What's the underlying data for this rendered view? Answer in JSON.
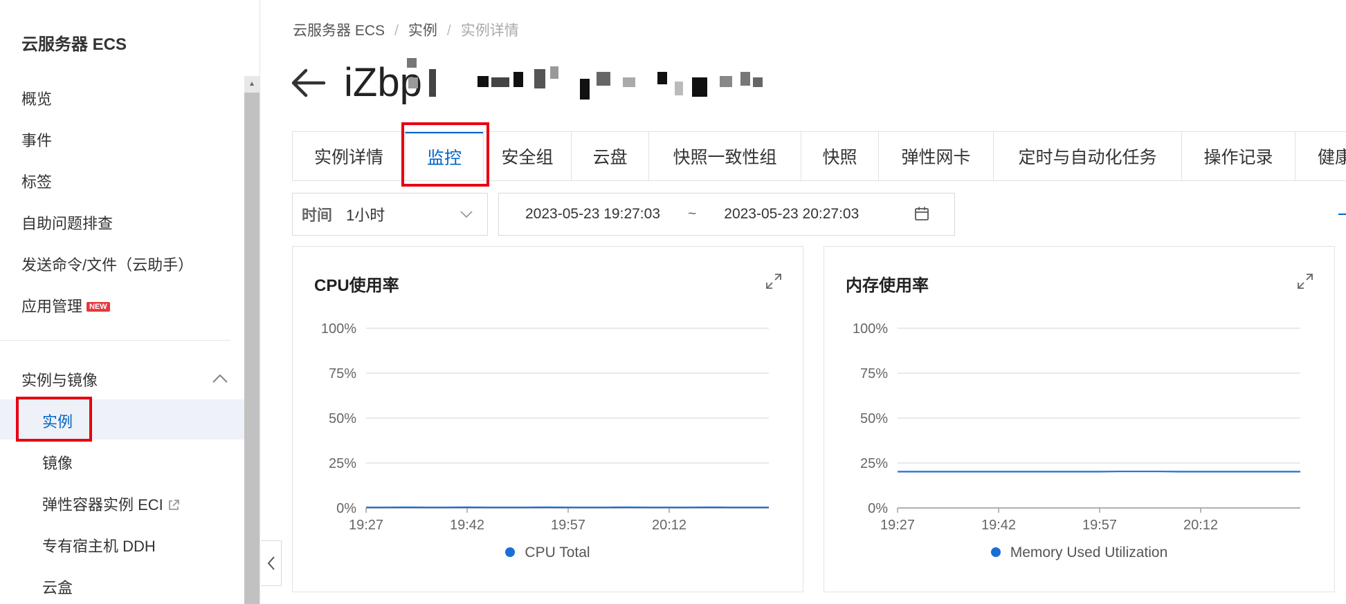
{
  "sidebar": {
    "title": "云服务器 ECS",
    "items": [
      {
        "label": "概览"
      },
      {
        "label": "事件"
      },
      {
        "label": "标签"
      },
      {
        "label": "自助问题排查"
      },
      {
        "label": "发送命令/文件（云助手）"
      },
      {
        "label": "应用管理",
        "badge": "NEW"
      }
    ],
    "group": {
      "label": "实例与镜像",
      "expanded": true,
      "children": [
        {
          "label": "实例",
          "active": true
        },
        {
          "label": "镜像"
        },
        {
          "label": "弹性容器实例 ECI",
          "external": true
        },
        {
          "label": "专有宿主机 DDH"
        },
        {
          "label": "云盒"
        }
      ]
    }
  },
  "breadcrumb": [
    "云服务器 ECS",
    "实例",
    "实例详情"
  ],
  "instance": {
    "id_prefix": "iZbp"
  },
  "tabs": [
    {
      "label": "实例详情"
    },
    {
      "label": "监控",
      "active": true
    },
    {
      "label": "安全组"
    },
    {
      "label": "云盘"
    },
    {
      "label": "快照一致性组"
    },
    {
      "label": "快照"
    },
    {
      "label": "弹性网卡"
    },
    {
      "label": "定时与自动化任务"
    },
    {
      "label": "操作记录"
    },
    {
      "label": "健康"
    }
  ],
  "filter": {
    "time_label": "时间",
    "time_value": "1小时",
    "start": "2023-05-23 19:27:03",
    "separator": "~",
    "end": "2023-05-23 20:27:03"
  },
  "icons": {
    "back": "arrow-left-icon",
    "calendar": "calendar-icon",
    "expand": "expand-icon",
    "collapse": "chevron-left-icon",
    "external": "external-link-icon"
  },
  "colors": {
    "accent": "#0064c8",
    "series": "#1a6fd4",
    "highlight": "#e60012",
    "badge": "#e4393c"
  },
  "charts": [
    {
      "title": "CPU使用率",
      "legend": "CPU Total",
      "chart_data": {
        "type": "line",
        "x_ticks": [
          "19:27",
          "19:42",
          "19:57",
          "20:12"
        ],
        "y_ticks": [
          "100%",
          "75%",
          "50%",
          "25%",
          "0%"
        ],
        "ylim": [
          0,
          100
        ],
        "series": [
          {
            "name": "CPU Total",
            "values": [
              0.3,
              0.3,
              0.4,
              0.3,
              0.3,
              0.4,
              0.3,
              0.3,
              0.3,
              0.4,
              0.3,
              0.3,
              0.3,
              0.4,
              0.3,
              0.3,
              0.3,
              0.4,
              0.3,
              0.3,
              0.3
            ]
          }
        ]
      }
    },
    {
      "title": "内存使用率",
      "legend": "Memory Used Utilization",
      "chart_data": {
        "type": "line",
        "x_ticks": [
          "19:27",
          "19:42",
          "19:57",
          "20:12"
        ],
        "y_ticks": [
          "100%",
          "75%",
          "50%",
          "25%",
          "0%"
        ],
        "ylim": [
          0,
          100
        ],
        "series": [
          {
            "name": "Memory Used Utilization",
            "values": [
              20.2,
              20.2,
              20.2,
              20.2,
              20.2,
              20.2,
              20.2,
              20.2,
              20.2,
              20.2,
              20.2,
              20.3,
              20.3,
              20.3,
              20.2,
              20.2,
              20.2,
              20.2,
              20.2,
              20.2,
              20.2
            ]
          }
        ]
      }
    }
  ]
}
